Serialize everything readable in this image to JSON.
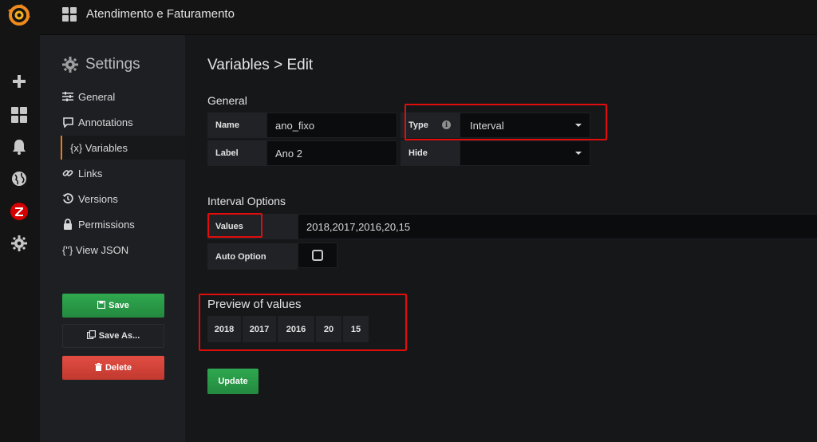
{
  "navbar": {
    "title": "Atendimento e Faturamento"
  },
  "settings": {
    "heading": "Settings",
    "items": [
      {
        "label": "General",
        "icon": "sliders-icon"
      },
      {
        "label": "Annotations",
        "icon": "comment-icon"
      },
      {
        "label": "{x} Variables",
        "icon": "variable-icon"
      },
      {
        "label": "Links",
        "icon": "link-icon"
      },
      {
        "label": "Versions",
        "icon": "history-icon"
      },
      {
        "label": "Permissions",
        "icon": "lock-icon"
      },
      {
        "label": "{\"} View JSON",
        "icon": "json-icon"
      }
    ],
    "save_label": "Save",
    "save_as_label": "Save As...",
    "delete_label": "Delete"
  },
  "main": {
    "title": "Variables > Edit",
    "general_heading": "General",
    "name_label": "Name",
    "name_value": "ano_fixo",
    "type_label": "Type",
    "type_value": "Interval",
    "label_label": "Label",
    "label_value": "Ano 2",
    "hide_label": "Hide",
    "hide_value": "",
    "interval_heading": "Interval Options",
    "values_label": "Values",
    "values_value": "2018,2017,2016,20,15",
    "auto_option_label": "Auto Option",
    "preview_heading": "Preview of values",
    "preview_values": [
      "2018",
      "2017",
      "2016",
      "20",
      "15"
    ],
    "update_label": "Update"
  },
  "colors": {
    "highlight": "#e10d0d",
    "accent": "#eb7b18",
    "primary_green": "#299c46",
    "danger_red": "#d44a3a"
  }
}
